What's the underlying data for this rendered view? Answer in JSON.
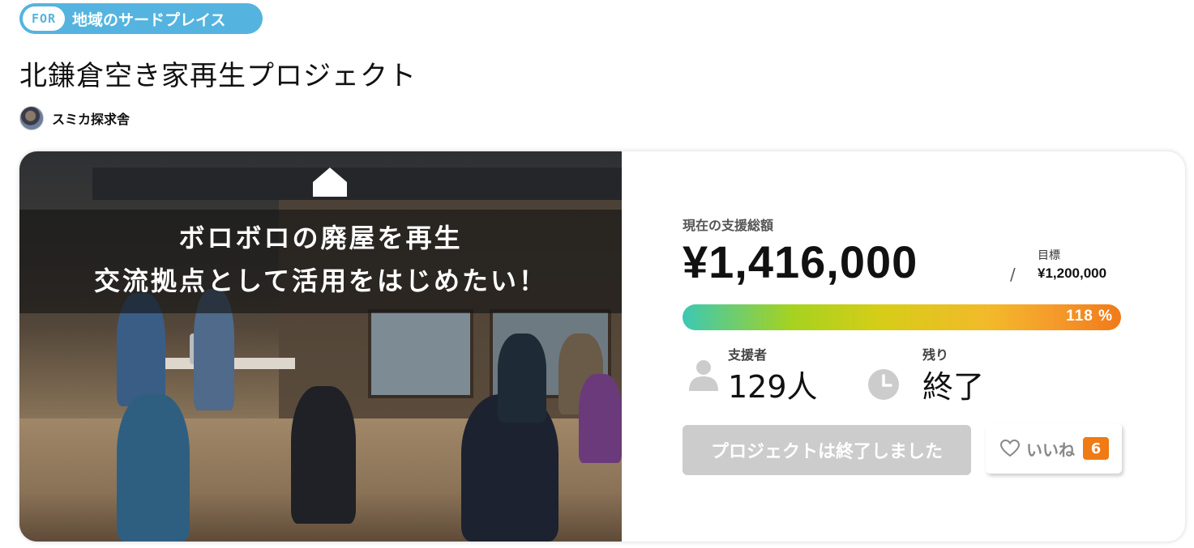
{
  "category_tag": {
    "prefix": "FOR",
    "label": "地域のサードプレイス",
    "color": "#55b4df"
  },
  "project": {
    "title": "北鎌倉空き家再生プロジェクト"
  },
  "owner": {
    "name": "スミカ探求舎"
  },
  "hero": {
    "line1": "ボロボロの廃屋を再生",
    "line2": "交流拠点として活用をはじめたい！",
    "icon": "house-icon"
  },
  "funding": {
    "current_label": "現在の支援総額",
    "current_amount": "¥1,416,000",
    "separator": "/",
    "goal_label": "目標",
    "goal_amount": "¥1,200,000",
    "progress_text": "118 %",
    "progress_percent": 118
  },
  "supporters": {
    "label": "支援者",
    "value": "129人",
    "icon": "person-icon"
  },
  "remaining": {
    "label": "残り",
    "value": "終了",
    "icon": "clock-icon"
  },
  "actions": {
    "ended_label": "プロジェクトは終了しました",
    "like_label": "いいね",
    "like_count": "6",
    "like_count_color": "#f07a14"
  }
}
